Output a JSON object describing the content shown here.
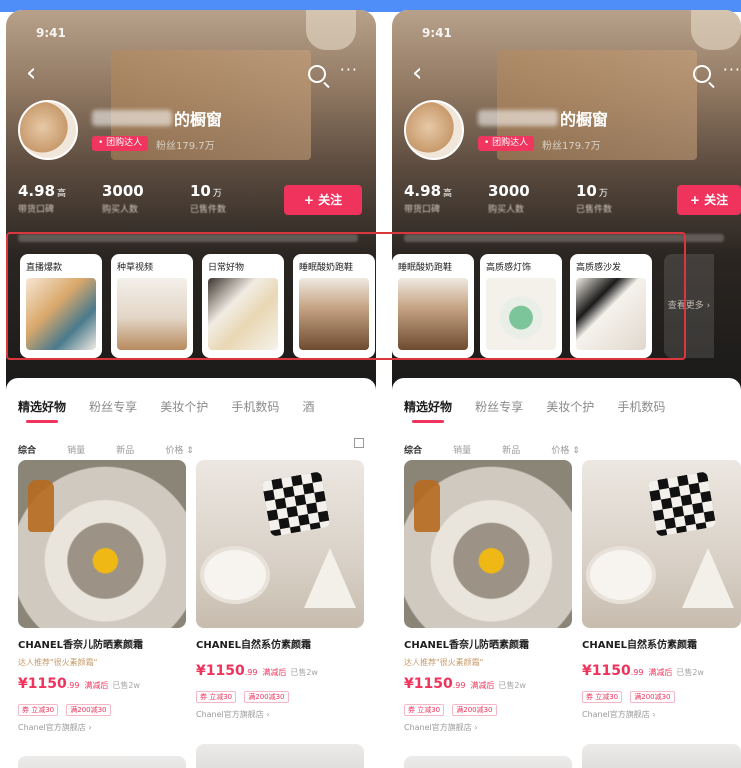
{
  "status": {
    "time": "9:41"
  },
  "colors": {
    "accent": "#f0335c",
    "frame_blue": "#4f8df8",
    "highlight_red": "#d9363e"
  },
  "icons": {
    "back": "back-arrow-icon",
    "search": "search-icon",
    "more": "more-icon"
  },
  "left": {
    "header": {
      "back_glyph": "‹",
      "more_glyph": "···"
    },
    "shop": {
      "name": "的橱窗",
      "badge": "• 团购达人",
      "followers": "粉丝179.7万",
      "stats": [
        {
          "value": "4.98",
          "unit": "高",
          "label": "带货口碑"
        },
        {
          "value": "3000",
          "unit": "",
          "label": "购买人数"
        },
        {
          "value": "10",
          "unit": "万",
          "label": "已售件数"
        }
      ],
      "follow_label": "+ 关注"
    },
    "categories": [
      {
        "title": "直播爆款"
      },
      {
        "title": "种草视频"
      },
      {
        "title": "日常好物"
      },
      {
        "title": "睡眠酸奶跑鞋"
      }
    ],
    "tabs": [
      "精选好物",
      "粉丝专享",
      "美妆个护",
      "手机数码",
      "酒"
    ],
    "sorts": [
      "综合",
      "销量",
      "新品",
      "价格 ⇕"
    ],
    "products": [
      {
        "title": "CHANEL香奈儿防晒素颜霜",
        "subtitle": "达人推荐\"很火素颜霜\"",
        "price": "¥1150",
        "price_decimal": ".99",
        "price_note": "满减后",
        "sold": "已售2w",
        "tags": [
          "券 立减30",
          "满200减30"
        ],
        "store": "Chanel官方旗舰店 ›"
      },
      {
        "title": "CHANEL自然系仿素颜霜",
        "subtitle": "",
        "price": "¥1150",
        "price_decimal": ".99",
        "price_note": "满减后",
        "sold": "已售2w",
        "tags": [
          "券 立减30",
          "满200减30"
        ],
        "store": "Chanel官方旗舰店 ›"
      }
    ]
  },
  "right": {
    "header": {
      "back_glyph": "‹",
      "more_glyph": "···"
    },
    "shop": {
      "name": "的橱窗",
      "badge": "• 团购达人",
      "followers": "粉丝179.7万",
      "stats": [
        {
          "value": "4.98",
          "unit": "高",
          "label": "带货口碑"
        },
        {
          "value": "3000",
          "unit": "",
          "label": "购买人数"
        },
        {
          "value": "10",
          "unit": "万",
          "label": "已售件数"
        }
      ],
      "follow_label": "+ 关注"
    },
    "categories": [
      {
        "title": "睡眠酸奶跑鞋"
      },
      {
        "title": "高质感灯饰"
      },
      {
        "title": "高质感沙发"
      }
    ],
    "more_label": "查看更多 ›",
    "tabs": [
      "精选好物",
      "粉丝专享",
      "美妆个护",
      "手机数码"
    ],
    "sorts": [
      "综合",
      "销量",
      "新品",
      "价格 ⇕"
    ],
    "products": [
      {
        "title": "CHANEL香奈儿防晒素颜霜",
        "subtitle": "达人推荐\"很火素颜霜\"",
        "price": "¥1150",
        "price_decimal": ".99",
        "price_note": "满减后",
        "sold": "已售2w",
        "tags": [
          "券 立减30",
          "满200减30"
        ],
        "store": "Chanel官方旗舰店 ›"
      },
      {
        "title": "CHANEL自然系仿素颜霜",
        "subtitle": "",
        "price": "¥1150",
        "price_decimal": ".99",
        "price_note": "满减后",
        "sold": "已售2w",
        "tags": [
          "券 立减30",
          "满200减30"
        ],
        "store": "Chanel官方旗舰店 ›"
      }
    ]
  }
}
